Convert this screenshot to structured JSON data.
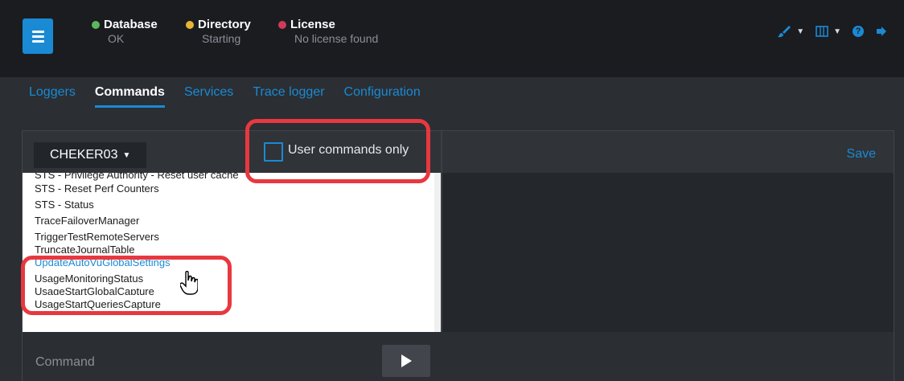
{
  "statuses": [
    {
      "label": "Database",
      "value": "OK",
      "color": "#5bb85b"
    },
    {
      "label": "Directory",
      "value": "Starting",
      "color": "#e6b533"
    },
    {
      "label": "License",
      "value": "No license found",
      "color": "#d23a5a"
    }
  ],
  "top_icons": [
    "brush-icon",
    "map-icon",
    "help-icon",
    "logout-icon"
  ],
  "tabs": [
    "Loggers",
    "Commands",
    "Services",
    "Trace logger",
    "Configuration"
  ],
  "active_tab": "Commands",
  "server": "CHEKER03",
  "user_commands_only": "User commands only",
  "save_label": "Save",
  "commands": [
    "STS - Privilege Authority - Reset user cache",
    "STS - Reset Perf Counters",
    "STS - Status",
    "TraceFailoverManager",
    "TriggerTestRemoteServers",
    "TruncateJournalTable",
    "UpdateAutoVuGlobalSettings",
    "UsageMonitoringStatus",
    "UsageStartGlobalCapture",
    "UsageStartQueriesCapture"
  ],
  "command_placeholder": "Command",
  "colors": {
    "accent": "#1a8ad4",
    "highlight_ring": "#e8383f"
  }
}
